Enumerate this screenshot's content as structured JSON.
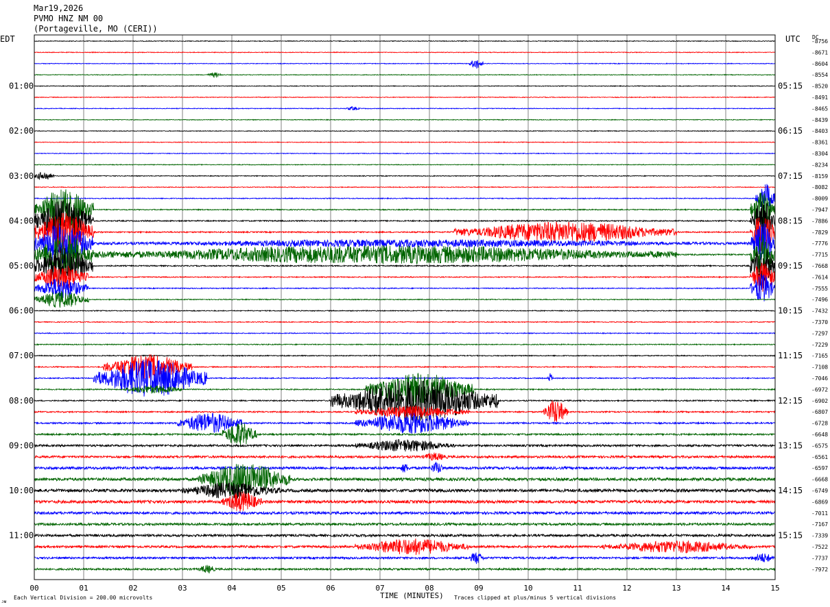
{
  "header": {
    "date": "Mar19,2026",
    "station": "PVMO HNZ NM 00",
    "location": "(Portageville, MO (CERI))"
  },
  "left_timezone": "EDT",
  "right_timezone": "UTC",
  "dc_label": "DC",
  "footer": {
    "scale_note": "Each Vertical Division =  200.00 microvolts",
    "xlabel": "TIME (MINUTES)",
    "clip_note": "Traces clipped at plus/minus 5 vertical divisions",
    "corner_mark": "ᴊᴍ"
  },
  "colors": {
    "trace_cycle": [
      "#000000",
      "#ff0000",
      "#0000ff",
      "#006400"
    ],
    "grid": "#808080",
    "frame": "#000000"
  },
  "chart_data": {
    "type": "line",
    "subtype": "helicorder",
    "xlabel": "TIME (MINUTES)",
    "xlim": [
      0,
      15
    ],
    "x_ticks": [
      "00",
      "01",
      "02",
      "03",
      "04",
      "05",
      "06",
      "07",
      "08",
      "09",
      "10",
      "11",
      "12",
      "13",
      "14",
      "15"
    ],
    "minutes_per_line": 15,
    "line_count": 48,
    "left_hour_labels": [
      {
        "line": 4,
        "label": "01:00"
      },
      {
        "line": 8,
        "label": "02:00"
      },
      {
        "line": 12,
        "label": "03:00"
      },
      {
        "line": 16,
        "label": "04:00"
      },
      {
        "line": 20,
        "label": "05:00"
      },
      {
        "line": 24,
        "label": "06:00"
      },
      {
        "line": 28,
        "label": "07:00"
      },
      {
        "line": 32,
        "label": "08:00"
      },
      {
        "line": 36,
        "label": "09:00"
      },
      {
        "line": 40,
        "label": "10:00"
      },
      {
        "line": 44,
        "label": "11:00"
      }
    ],
    "right_hour_labels": [
      {
        "line": 4,
        "label": "05:15"
      },
      {
        "line": 8,
        "label": "06:15"
      },
      {
        "line": 12,
        "label": "07:15"
      },
      {
        "line": 16,
        "label": "08:15"
      },
      {
        "line": 20,
        "label": "09:15"
      },
      {
        "line": 24,
        "label": "10:15"
      },
      {
        "line": 28,
        "label": "11:15"
      },
      {
        "line": 32,
        "label": "12:15"
      },
      {
        "line": 36,
        "label": "13:15"
      },
      {
        "line": 40,
        "label": "14:15"
      },
      {
        "line": 44,
        "label": "15:15"
      }
    ],
    "dc_offsets": [
      "-8756",
      "-8671",
      "-8604",
      "-8554",
      "-8520",
      "-8491",
      "-8465",
      "-8439",
      "-8403",
      "-8361",
      "-8304",
      "-8234",
      "-8159",
      "-8082",
      "-8009",
      "-7947",
      "-7886",
      "-7829",
      "-7776",
      "-7715",
      "-7668",
      "-7614",
      "-7555",
      "-7496",
      "-7432",
      "-7370",
      "-7297",
      "-7229",
      "-7165",
      "-7108",
      "-7046",
      "-6972",
      "-6902",
      "-6807",
      "-6728",
      "-6648",
      "-6575",
      "-6561",
      "-6597",
      "-6668",
      "-6749",
      "-6869",
      "-7011",
      "-7167",
      "-7339",
      "-7522",
      "-7737",
      "-7972"
    ],
    "noise_level": [
      0.08,
      0.08,
      0.08,
      0.08,
      0.08,
      0.08,
      0.08,
      0.08,
      0.08,
      0.08,
      0.08,
      0.08,
      0.09,
      0.09,
      0.1,
      0.12,
      0.14,
      0.15,
      0.16,
      0.16,
      0.14,
      0.12,
      0.11,
      0.1,
      0.1,
      0.1,
      0.1,
      0.11,
      0.11,
      0.12,
      0.12,
      0.13,
      0.14,
      0.16,
      0.18,
      0.2,
      0.24,
      0.26,
      0.3,
      0.34,
      0.36,
      0.34,
      0.3,
      0.28,
      0.28,
      0.26,
      0.24,
      0.22
    ],
    "events": [
      {
        "line": 2,
        "start_min": 8.8,
        "end_min": 9.1,
        "amplitude": 1.2
      },
      {
        "line": 3,
        "start_min": 3.5,
        "end_min": 3.8,
        "amplitude": 0.6
      },
      {
        "line": 6,
        "start_min": 6.3,
        "end_min": 6.6,
        "amplitude": 0.5
      },
      {
        "line": 12,
        "start_min": 0.0,
        "end_min": 0.4,
        "amplitude": 1.1
      },
      {
        "line": 14,
        "start_min": 14.6,
        "end_min": 15.0,
        "amplitude": 3.5
      },
      {
        "line": 15,
        "start_min": 0.0,
        "end_min": 1.2,
        "amplitude": 5.0
      },
      {
        "line": 15,
        "start_min": 14.5,
        "end_min": 15.0,
        "amplitude": 5.0
      },
      {
        "line": 16,
        "start_min": 0.0,
        "end_min": 1.2,
        "amplitude": 5.0
      },
      {
        "line": 16,
        "start_min": 14.5,
        "end_min": 15.0,
        "amplitude": 5.0
      },
      {
        "line": 17,
        "start_min": 0.0,
        "end_min": 1.2,
        "amplitude": 5.0
      },
      {
        "line": 17,
        "start_min": 8.5,
        "end_min": 13.0,
        "amplitude": 2.5
      },
      {
        "line": 17,
        "start_min": 14.5,
        "end_min": 15.0,
        "amplitude": 5.0
      },
      {
        "line": 18,
        "start_min": 0.0,
        "end_min": 1.2,
        "amplitude": 5.0
      },
      {
        "line": 18,
        "start_min": 1.2,
        "end_min": 14.5,
        "amplitude": 0.9
      },
      {
        "line": 18,
        "start_min": 14.5,
        "end_min": 15.0,
        "amplitude": 5.0
      },
      {
        "line": 19,
        "start_min": 0.0,
        "end_min": 1.2,
        "amplitude": 5.0
      },
      {
        "line": 19,
        "start_min": 1.2,
        "end_min": 13.0,
        "amplitude": 2.2
      },
      {
        "line": 19,
        "start_min": 14.5,
        "end_min": 15.0,
        "amplitude": 5.0
      },
      {
        "line": 20,
        "start_min": 0.0,
        "end_min": 1.2,
        "amplitude": 4.5
      },
      {
        "line": 20,
        "start_min": 14.5,
        "end_min": 15.0,
        "amplitude": 5.0
      },
      {
        "line": 21,
        "start_min": 0.0,
        "end_min": 1.1,
        "amplitude": 3.0
      },
      {
        "line": 21,
        "start_min": 14.5,
        "end_min": 15.0,
        "amplitude": 4.0
      },
      {
        "line": 22,
        "start_min": 0.0,
        "end_min": 1.1,
        "amplitude": 2.5
      },
      {
        "line": 22,
        "start_min": 14.5,
        "end_min": 15.0,
        "amplitude": 3.5
      },
      {
        "line": 23,
        "start_min": 0.0,
        "end_min": 1.1,
        "amplitude": 2.0
      },
      {
        "line": 29,
        "start_min": 1.4,
        "end_min": 3.2,
        "amplitude": 3.0
      },
      {
        "line": 30,
        "start_min": 1.2,
        "end_min": 3.5,
        "amplitude": 4.5
      },
      {
        "line": 30,
        "start_min": 10.4,
        "end_min": 10.5,
        "amplitude": 1.2
      },
      {
        "line": 31,
        "start_min": 1.8,
        "end_min": 3.0,
        "amplitude": 1.0
      },
      {
        "line": 31,
        "start_min": 6.7,
        "end_min": 8.9,
        "amplitude": 4.0
      },
      {
        "line": 32,
        "start_min": 6.0,
        "end_min": 9.4,
        "amplitude": 5.0
      },
      {
        "line": 33,
        "start_min": 6.5,
        "end_min": 8.8,
        "amplitude": 1.5
      },
      {
        "line": 33,
        "start_min": 10.3,
        "end_min": 10.8,
        "amplitude": 3.0
      },
      {
        "line": 34,
        "start_min": 2.9,
        "end_min": 4.2,
        "amplitude": 2.5
      },
      {
        "line": 34,
        "start_min": 6.5,
        "end_min": 8.8,
        "amplitude": 2.5
      },
      {
        "line": 35,
        "start_min": 3.8,
        "end_min": 4.5,
        "amplitude": 3.0
      },
      {
        "line": 36,
        "start_min": 6.5,
        "end_min": 8.5,
        "amplitude": 1.5
      },
      {
        "line": 37,
        "start_min": 7.8,
        "end_min": 8.4,
        "amplitude": 1.0
      },
      {
        "line": 38,
        "start_min": 7.4,
        "end_min": 7.6,
        "amplitude": 1.2
      },
      {
        "line": 38,
        "start_min": 8.0,
        "end_min": 8.3,
        "amplitude": 1.5
      },
      {
        "line": 39,
        "start_min": 3.3,
        "end_min": 5.2,
        "amplitude": 4.0
      },
      {
        "line": 40,
        "start_min": 3.0,
        "end_min": 5.0,
        "amplitude": 2.0
      },
      {
        "line": 41,
        "start_min": 3.8,
        "end_min": 4.6,
        "amplitude": 2.5
      },
      {
        "line": 45,
        "start_min": 6.5,
        "end_min": 8.8,
        "amplitude": 2.0
      },
      {
        "line": 45,
        "start_min": 11.5,
        "end_min": 14.5,
        "amplitude": 1.5
      },
      {
        "line": 46,
        "start_min": 8.8,
        "end_min": 9.1,
        "amplitude": 1.5
      },
      {
        "line": 46,
        "start_min": 14.5,
        "end_min": 15.0,
        "amplitude": 1.2
      },
      {
        "line": 47,
        "start_min": 3.3,
        "end_min": 3.7,
        "amplitude": 1.0
      }
    ]
  }
}
